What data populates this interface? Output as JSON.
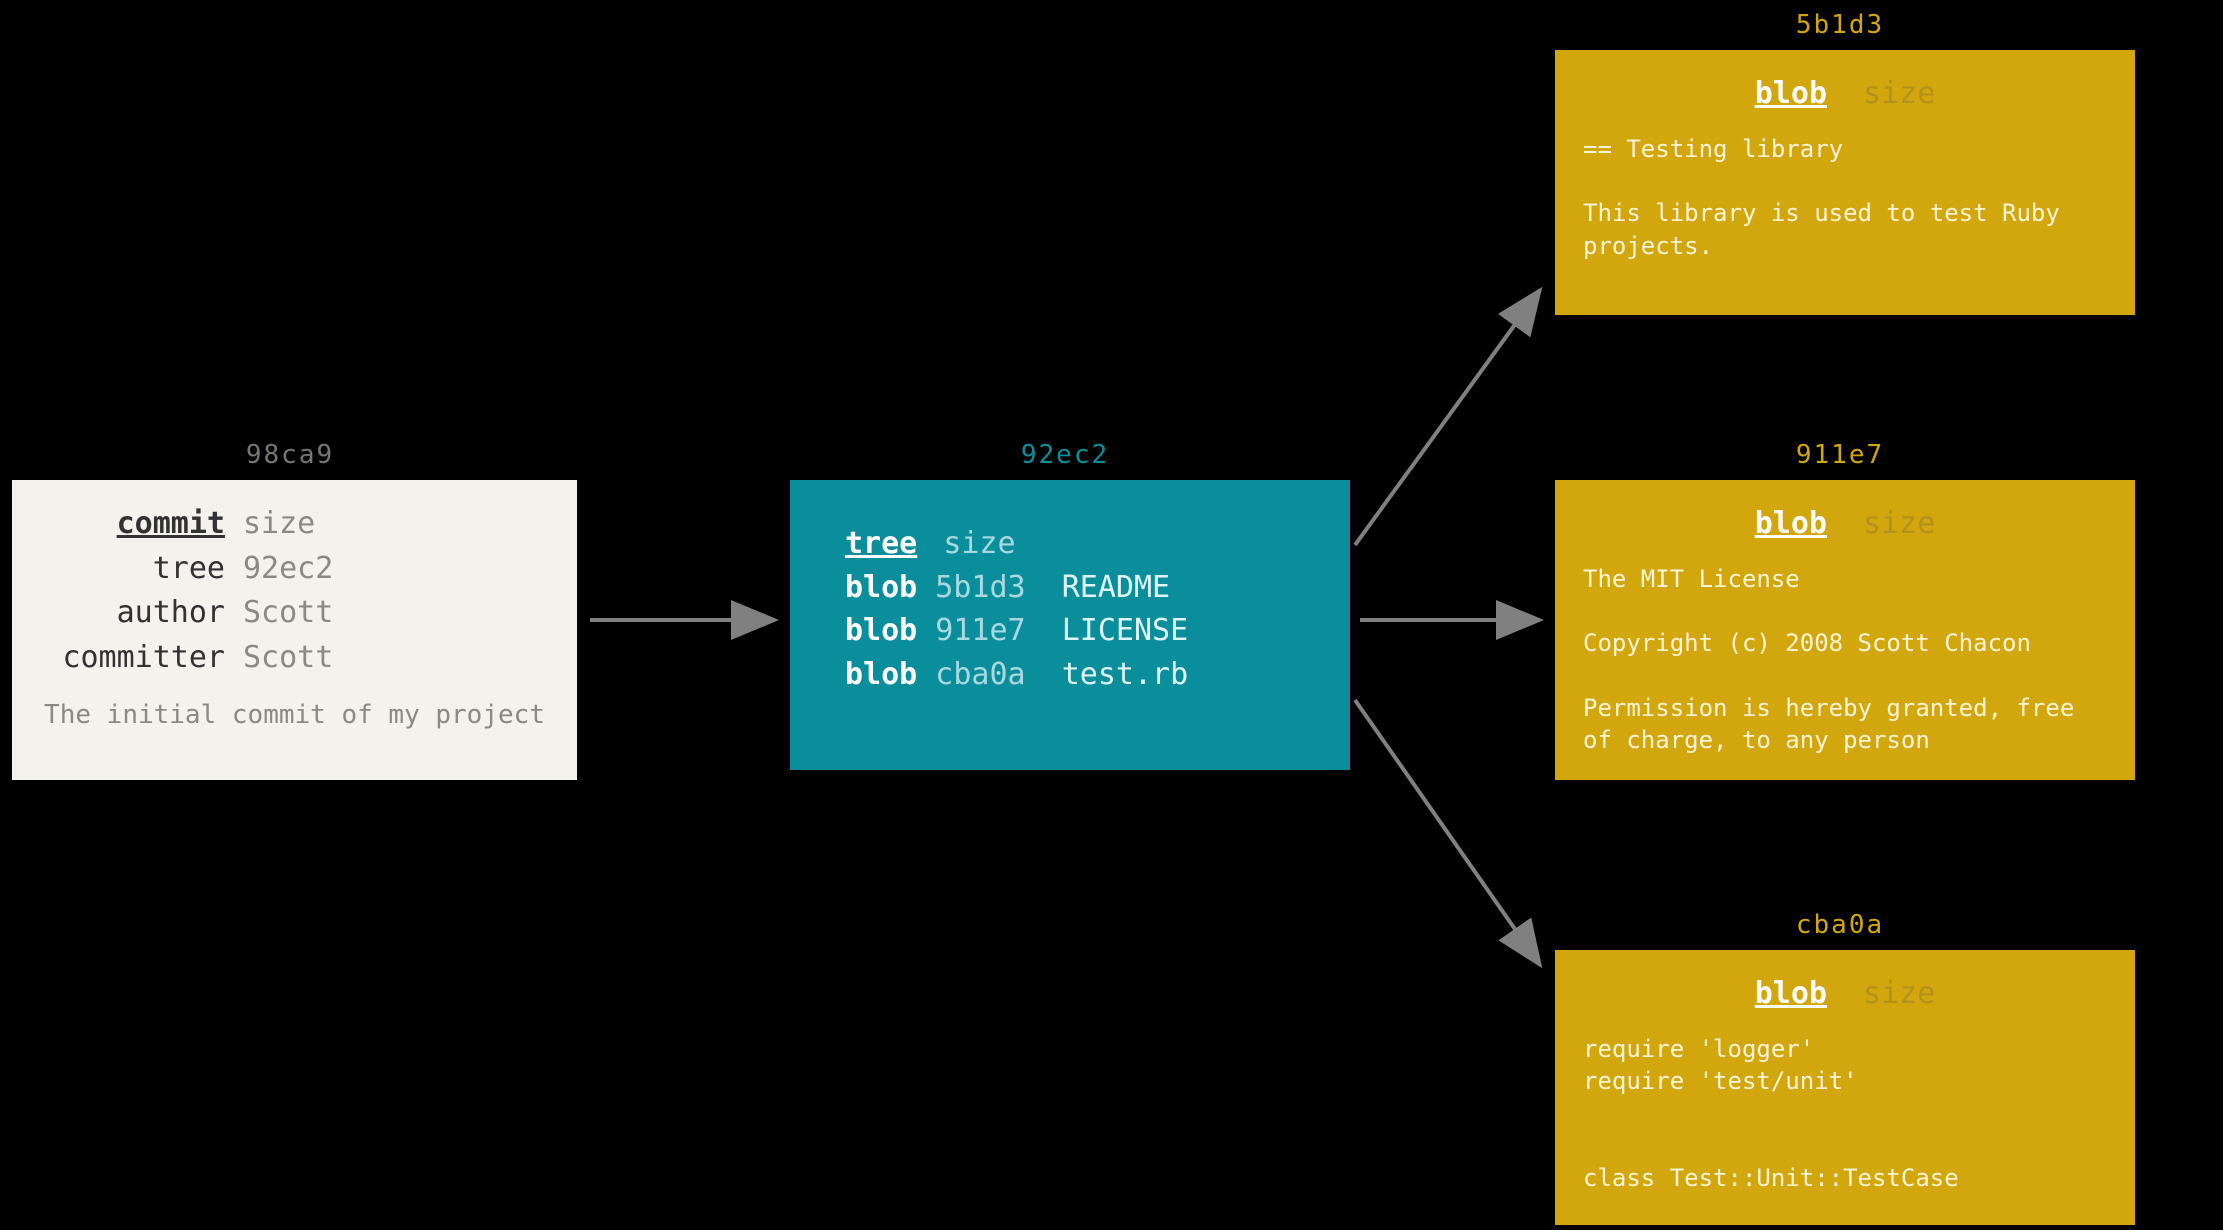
{
  "commit": {
    "hash": "98ca9",
    "type_label": "commit",
    "size_label": "size",
    "tree_key": "tree",
    "tree_value": "92ec2",
    "author_key": "author",
    "author_value": "Scott",
    "committer_key": "committer",
    "committer_value": "Scott",
    "message": "The initial commit of my project"
  },
  "tree": {
    "hash": "92ec2",
    "type_label": "tree",
    "size_label": "size",
    "entries": [
      {
        "type": "blob",
        "hash": "5b1d3",
        "name": "README"
      },
      {
        "type": "blob",
        "hash": "911e7",
        "name": "LICENSE"
      },
      {
        "type": "blob",
        "hash": "cba0a",
        "name": "test.rb"
      }
    ]
  },
  "blobs": [
    {
      "hash": "5b1d3",
      "type_label": "blob",
      "size_label": "size",
      "content": "== Testing library\n\nThis library is used to test Ruby projects."
    },
    {
      "hash": "911e7",
      "type_label": "blob",
      "size_label": "size",
      "content": "The MIT License\n\nCopyright (c) 2008 Scott Chacon\n\nPermission is hereby granted, free of charge, to any person"
    },
    {
      "hash": "cba0a",
      "type_label": "blob",
      "size_label": "size",
      "content": "require 'logger'\nrequire 'test/unit'\n\n\nclass Test::Unit::TestCase"
    }
  ]
}
